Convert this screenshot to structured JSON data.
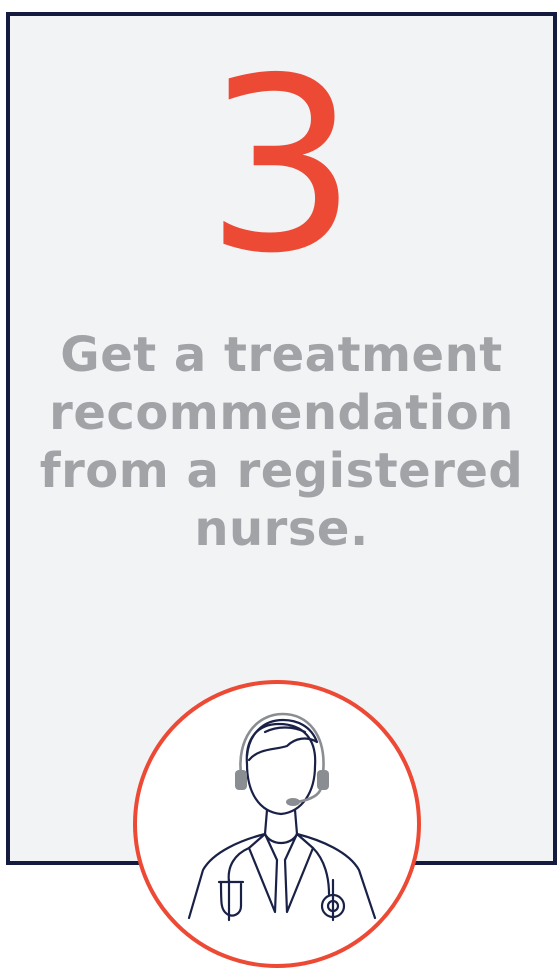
{
  "step": {
    "number": "3",
    "text": "Get a treatment recommendation from a registered nurse."
  },
  "icon": {
    "name": "nurse-with-headset-icon"
  },
  "colors": {
    "accent": "#ec4a35",
    "border": "#141b3f",
    "card_background": "#f2f3f5",
    "text": "#a1a3a6"
  }
}
